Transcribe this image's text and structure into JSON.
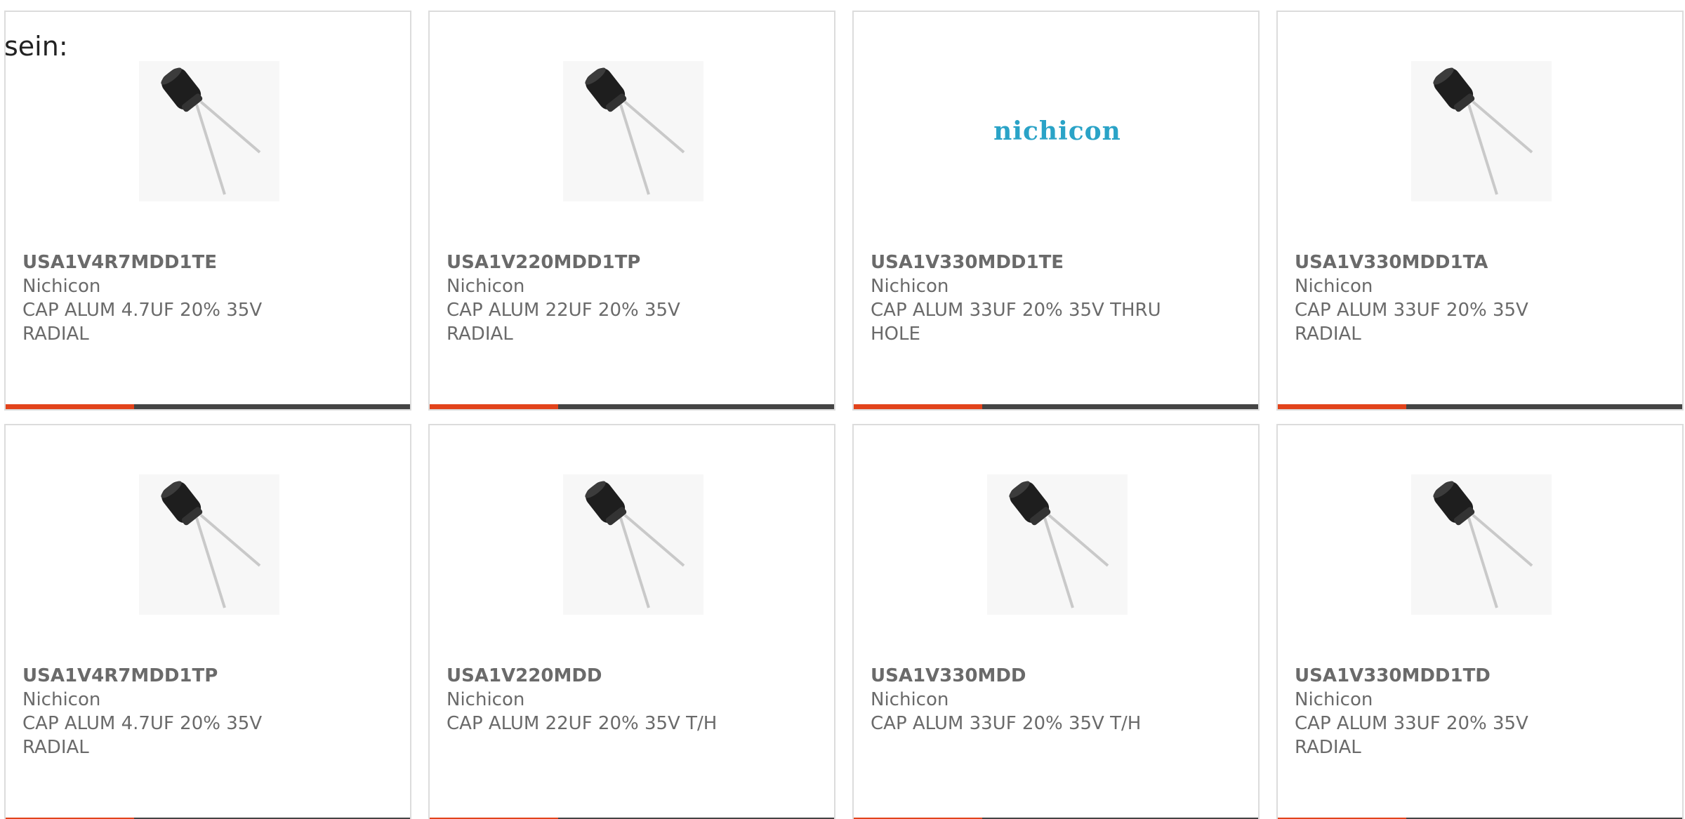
{
  "leading_text": "sein:",
  "colors": {
    "accent": "#e2431b",
    "bar": "#444444",
    "text": "#6a6a6a",
    "logo": "#2aa3c7"
  },
  "products": [
    {
      "part_number": "USA1V4R7MDD1TE",
      "manufacturer": "Nichicon",
      "desc_line1": "CAP ALUM 4.7UF 20% 35V",
      "desc_line2": "RADIAL",
      "image": "capacitor-image"
    },
    {
      "part_number": "USA1V220MDD1TP",
      "manufacturer": "Nichicon",
      "desc_line1": "CAP ALUM 22UF 20% 35V",
      "desc_line2": "RADIAL",
      "image": "capacitor-image"
    },
    {
      "part_number": "USA1V330MDD1TE",
      "manufacturer": "Nichicon",
      "desc_line1": "CAP ALUM 33UF 20% 35V THRU",
      "desc_line2": "HOLE",
      "image": "nichicon-logo",
      "logo_text": "nichicon"
    },
    {
      "part_number": "USA1V330MDD1TA",
      "manufacturer": "Nichicon",
      "desc_line1": "CAP ALUM 33UF 20% 35V",
      "desc_line2": "RADIAL",
      "image": "capacitor-image"
    },
    {
      "part_number": "USA1V4R7MDD1TP",
      "manufacturer": "Nichicon",
      "desc_line1": "CAP ALUM 4.7UF 20% 35V",
      "desc_line2": "RADIAL",
      "image": "capacitor-image"
    },
    {
      "part_number": "USA1V220MDD",
      "manufacturer": "Nichicon",
      "desc_line1": "CAP ALUM 22UF 20% 35V T/H",
      "desc_line2": "",
      "image": "capacitor-image"
    },
    {
      "part_number": "USA1V330MDD",
      "manufacturer": "Nichicon",
      "desc_line1": "CAP ALUM 33UF 20% 35V T/H",
      "desc_line2": "",
      "image": "capacitor-image"
    },
    {
      "part_number": "USA1V330MDD1TD",
      "manufacturer": "Nichicon",
      "desc_line1": "CAP ALUM 33UF 20% 35V",
      "desc_line2": "RADIAL",
      "image": "capacitor-image"
    }
  ]
}
